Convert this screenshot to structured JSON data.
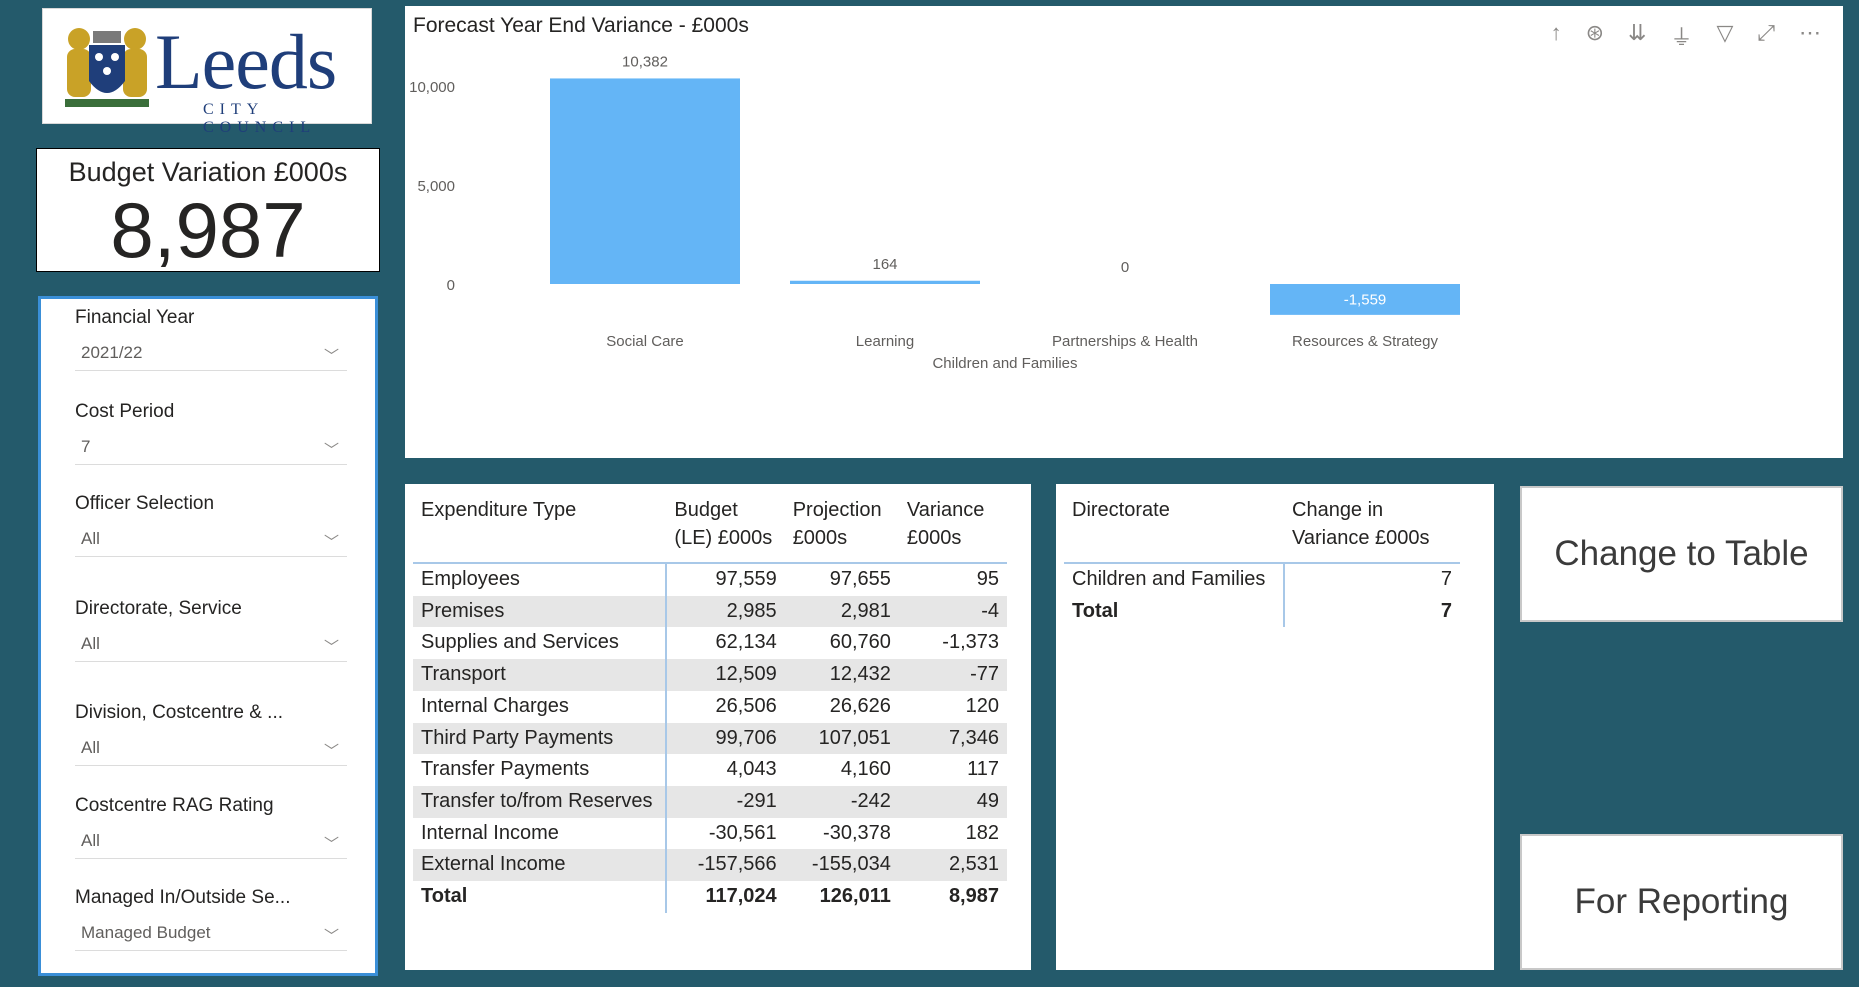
{
  "logo": {
    "name": "Leeds",
    "sub": "CITY COUNCIL"
  },
  "kpi": {
    "label": "Budget Variation £000s",
    "value": "8,987"
  },
  "slicers": [
    {
      "title": "Financial Year",
      "value": "2021/22"
    },
    {
      "title": "Cost Period",
      "value": "7"
    },
    {
      "title": "Officer Selection",
      "value": "All"
    },
    {
      "title": "Directorate, Service",
      "value": "All"
    },
    {
      "title": "Division, Costcentre & ...",
      "value": "All"
    },
    {
      "title": "Costcentre RAG Rating",
      "value": "All"
    },
    {
      "title": "Managed In/Outside Se...",
      "value": "Managed Budget"
    }
  ],
  "chart": {
    "title": "Forecast Year End Variance - £000s",
    "toolbar": [
      "↑",
      "⊛",
      "⇊",
      "⏚",
      "▽",
      "⤢",
      "⋯"
    ]
  },
  "chart_data": {
    "type": "bar",
    "title": "Forecast Year End Variance - £000s",
    "categories": [
      "Social Care",
      "Learning",
      "Partnerships & Health",
      "Resources & Strategy"
    ],
    "values": [
      10382,
      164,
      0,
      -1559
    ],
    "value_labels": [
      "10,382",
      "164",
      "0",
      "-1,559"
    ],
    "group_label": "Children and Families",
    "yticks": [
      "0",
      "5,000",
      "10,000"
    ],
    "ylim": [
      -2000,
      12000
    ],
    "bar_color": "#64b5f6",
    "grid": false
  },
  "expenditure": {
    "headers": [
      "Expenditure Type",
      "Budget (LE) £000s",
      "Projection £000s",
      "Variance £000s"
    ],
    "rows": [
      [
        "Employees",
        "97,559",
        "97,655",
        "95"
      ],
      [
        "Premises",
        "2,985",
        "2,981",
        "-4"
      ],
      [
        "Supplies and Services",
        "62,134",
        "60,760",
        "-1,373"
      ],
      [
        "Transport",
        "12,509",
        "12,432",
        "-77"
      ],
      [
        "Internal Charges",
        "26,506",
        "26,626",
        "120"
      ],
      [
        "Third Party Payments",
        "99,706",
        "107,051",
        "7,346"
      ],
      [
        "Transfer Payments",
        "4,043",
        "4,160",
        "117"
      ],
      [
        "Transfer to/from Reserves",
        "-291",
        "-242",
        "49"
      ],
      [
        "Internal Income",
        "-30,561",
        "-30,378",
        "182"
      ],
      [
        "External Income",
        "-157,566",
        "-155,034",
        "2,531"
      ]
    ],
    "total": [
      "Total",
      "117,024",
      "126,011",
      "8,987"
    ]
  },
  "directorate": {
    "headers": [
      "Directorate",
      "Change in Variance £000s"
    ],
    "rows": [
      [
        "Children and Families",
        "7"
      ]
    ],
    "total": [
      "Total",
      "7"
    ]
  },
  "buttons": {
    "table": "Change to Table",
    "report": "For Reporting"
  }
}
